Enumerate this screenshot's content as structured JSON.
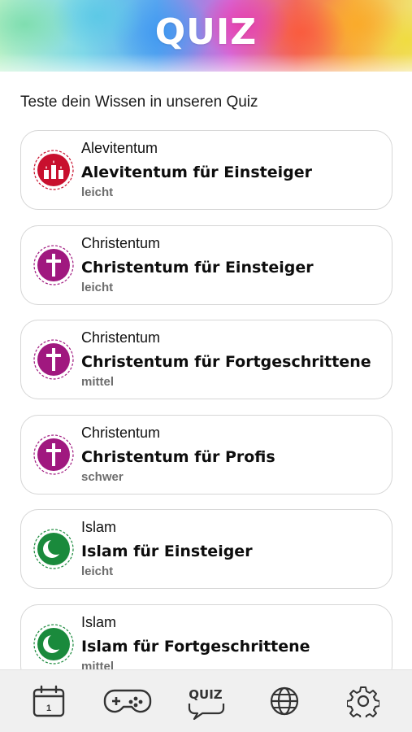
{
  "header": {
    "title": "QUIZ"
  },
  "subtitle": "Teste dein Wissen in unseren Quiz",
  "quizzes": [
    {
      "category": "Alevitentum",
      "title": "Alevitentum für Einsteiger",
      "level": "leicht",
      "icon": "candles-icon",
      "color": "#c8102e"
    },
    {
      "category": "Christentum",
      "title": "Christentum für Einsteiger",
      "level": "leicht",
      "icon": "cross-icon",
      "color": "#a0187f"
    },
    {
      "category": "Christentum",
      "title": "Christentum für Fortgeschrittene",
      "level": "mittel",
      "icon": "cross-icon",
      "color": "#a0187f"
    },
    {
      "category": "Christentum",
      "title": "Christentum für Profis",
      "level": "schwer",
      "icon": "cross-icon",
      "color": "#a0187f"
    },
    {
      "category": "Islam",
      "title": "Islam für Einsteiger",
      "level": "leicht",
      "icon": "crescent-icon",
      "color": "#1a8a3c"
    },
    {
      "category": "Islam",
      "title": "Islam für Fortgeschrittene",
      "level": "mittel",
      "icon": "crescent-icon",
      "color": "#1a8a3c"
    }
  ],
  "tabbar": {
    "calendar_day": "1",
    "quiz_label": "QUIZ",
    "icons": [
      "calendar-icon",
      "gamepad-icon",
      "quiz-bubble-icon",
      "globe-icon",
      "gear-icon"
    ]
  }
}
